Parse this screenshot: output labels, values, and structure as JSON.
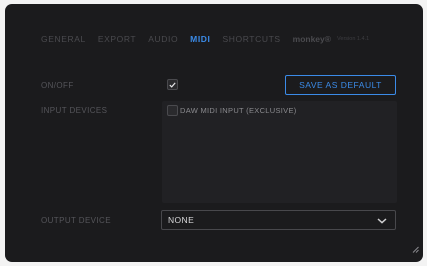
{
  "tabs": {
    "general": "GENERAL",
    "export": "EXPORT",
    "audio": "AUDIO",
    "midi": "MIDI",
    "shortcuts": "SHORTCUTS",
    "brand": "monkey®",
    "version": "Version 1.4.1",
    "active": "MIDI"
  },
  "midi": {
    "onoff_label": "ON/OFF",
    "onoff_checked": true,
    "save_default_label": "SAVE AS DEFAULT",
    "input_devices_label": "INPUT DEVICES",
    "input_devices": [
      {
        "name": "DAW MIDI INPUT (EXCLUSIVE)",
        "checked": false
      }
    ],
    "output_device_label": "OUTPUT DEVICE",
    "output_device_value": "NONE"
  },
  "colors": {
    "accent": "#3b8be8",
    "panel_bg": "#1b1b1d",
    "list_bg": "#212124",
    "muted_text": "#55555a"
  },
  "icons": [
    "checkmark-icon",
    "chevron-down-icon",
    "resize-grip-icon"
  ]
}
